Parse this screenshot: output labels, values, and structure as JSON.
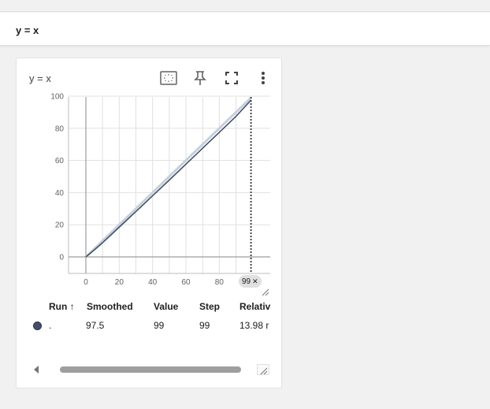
{
  "group": {
    "title": "y = x"
  },
  "card": {
    "title": "y = x",
    "toolbar": {
      "fit_icon": "fit-domain-icon",
      "pin_icon": "pin-icon",
      "fullscreen_icon": "fullscreen-icon",
      "more_icon": "more-vert-icon"
    },
    "step_chip": {
      "label": "99",
      "close": "✕"
    },
    "table": {
      "headers": {
        "run": "Run",
        "run_sort": "↑",
        "smoothed": "Smoothed",
        "value": "Value",
        "step": "Step",
        "relative": "Relativ"
      },
      "row": {
        "run": ".",
        "smoothed": "97.5",
        "value": "99",
        "step": "99",
        "relative": "13.98 r"
      }
    }
  },
  "colors": {
    "series": "#425066",
    "series_light": "#c5d0dc",
    "grid": "#e0e0e0",
    "axis": "#9e9e9e"
  },
  "chart_data": {
    "type": "line",
    "title": "y = x",
    "xlabel": "",
    "ylabel": "",
    "xlim": [
      0,
      99
    ],
    "ylim": [
      0,
      100
    ],
    "x_ticks": [
      "0",
      "20",
      "40",
      "60",
      "80"
    ],
    "y_ticks": [
      "0",
      "20",
      "40",
      "60",
      "80",
      "100"
    ],
    "series": [
      {
        "x": [
          0,
          5,
          10,
          20,
          30,
          40,
          50,
          60,
          70,
          80,
          90,
          99
        ],
        "smoothed": [
          0,
          4.3,
          8.8,
          18.5,
          28.2,
          38.0,
          47.8,
          57.7,
          67.6,
          77.5,
          87.4,
          97.5
        ],
        "values": [
          0,
          5,
          10,
          20,
          30,
          40,
          50,
          60,
          70,
          80,
          90,
          99
        ]
      }
    ],
    "hover_step": 99
  }
}
